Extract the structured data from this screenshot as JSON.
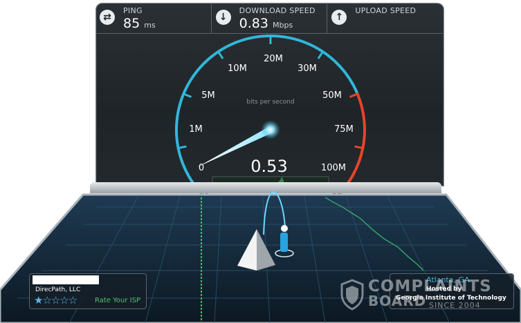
{
  "stats": {
    "ping": {
      "label": "PING",
      "value": "85",
      "unit": "ms",
      "icon": "ping-arrows-icon"
    },
    "download": {
      "label": "DOWNLOAD SPEED",
      "value": "0.83",
      "unit": "Mbps",
      "icon": "download-arrow-icon"
    },
    "upload": {
      "label": "UPLOAD SPEED",
      "value": "",
      "unit": "",
      "icon": "upload-arrow-icon"
    }
  },
  "gauge": {
    "caption": "bits per second",
    "current_reading": "0.53",
    "needle_value_mbps": 0.53,
    "scale_labels": [
      "0",
      "1M",
      "5M",
      "10M",
      "20M",
      "30M",
      "50M",
      "75M",
      "100M"
    ],
    "colors": {
      "arc_normal": "#31b7d9",
      "arc_high": "#e6452a",
      "needle": "#e8fbff"
    }
  },
  "isp": {
    "name": "DirecPath, LLC",
    "rating_stars": "★☆☆☆☆",
    "rating_value": 1,
    "rate_label": "Rate Your ISP"
  },
  "server": {
    "location": "Atlanta, GA",
    "hosted_by_label": "Hosted by",
    "host_name": "Georgia Institute of Technology"
  },
  "watermark": {
    "line1": "COMPLAINTS",
    "line2": "BOARD",
    "since": "SINCE 2004"
  }
}
